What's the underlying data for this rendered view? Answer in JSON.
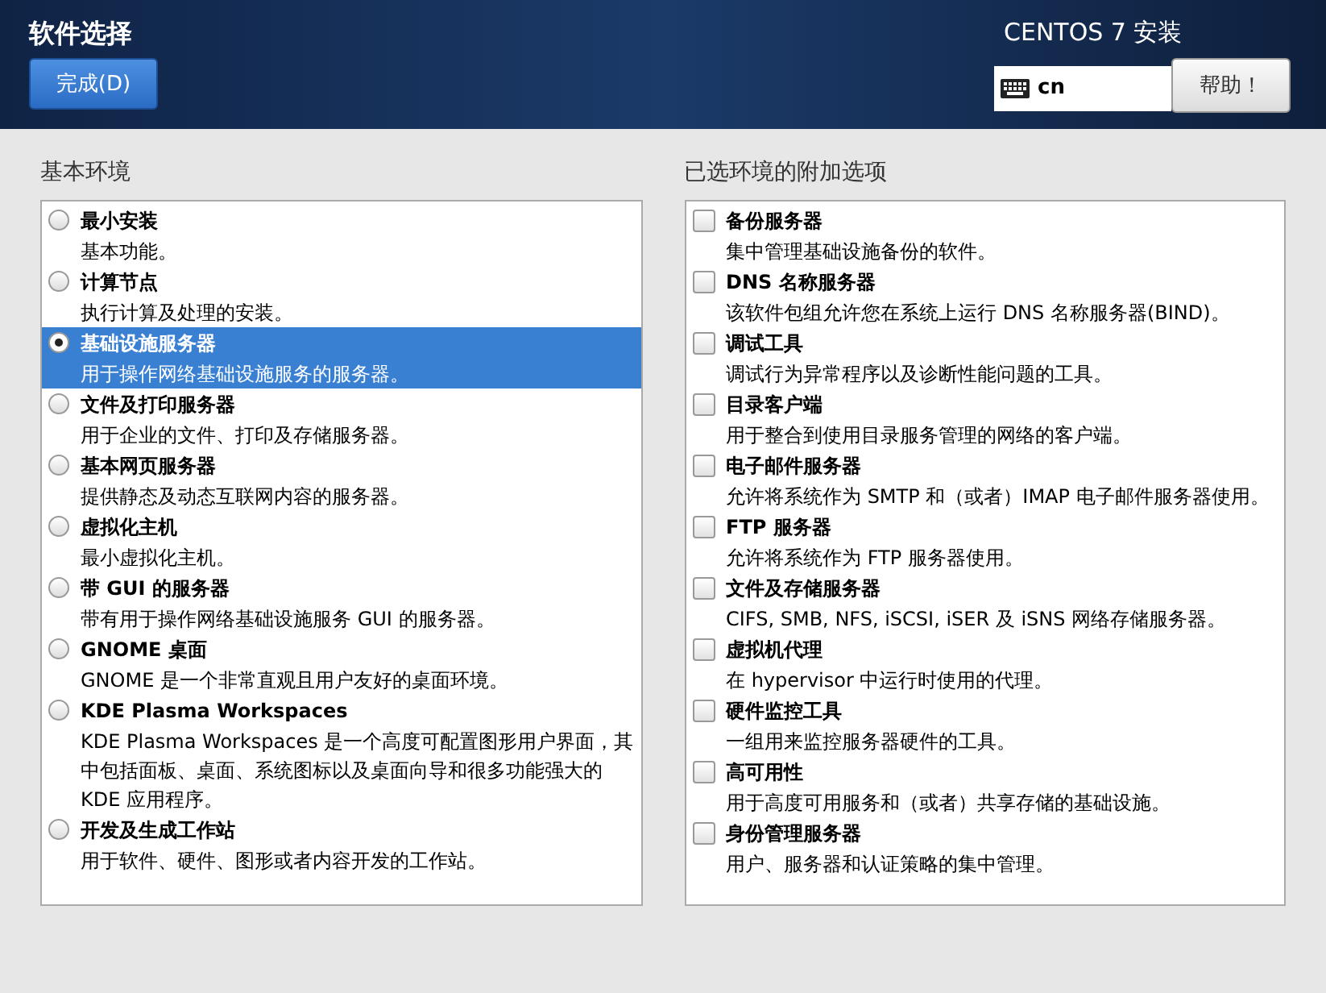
{
  "header": {
    "title": "软件选择",
    "done_button": "完成(D)",
    "product": "CENTOS 7 安装",
    "keyboard": "cn",
    "help_button": "帮助！"
  },
  "environments": {
    "heading": "基本环境",
    "items": [
      {
        "name": "最小安装",
        "description": "基本功能。",
        "selected": false
      },
      {
        "name": "计算节点",
        "description": "执行计算及处理的安装。",
        "selected": false
      },
      {
        "name": "基础设施服务器",
        "description": "用于操作网络基础设施服务的服务器。",
        "selected": true
      },
      {
        "name": "文件及打印服务器",
        "description": "用于企业的文件、打印及存储服务器。",
        "selected": false
      },
      {
        "name": "基本网页服务器",
        "description": "提供静态及动态互联网内容的服务器。",
        "selected": false
      },
      {
        "name": "虚拟化主机",
        "description": "最小虚拟化主机。",
        "selected": false
      },
      {
        "name": "带 GUI 的服务器",
        "description": "带有用于操作网络基础设施服务 GUI 的服务器。",
        "selected": false
      },
      {
        "name": "GNOME 桌面",
        "description": "GNOME 是一个非常直观且用户友好的桌面环境。",
        "selected": false
      },
      {
        "name": "KDE Plasma Workspaces",
        "description": "KDE Plasma Workspaces 是一个高度可配置图形用户界面，其中包括面板、桌面、系统图标以及桌面向导和很多功能强大的 KDE 应用程序。",
        "selected": false
      },
      {
        "name": "开发及生成工作站",
        "description": "用于软件、硬件、图形或者内容开发的工作站。",
        "selected": false
      }
    ]
  },
  "addons": {
    "heading": "已选环境的附加选项",
    "items": [
      {
        "name": "备份服务器",
        "description": "集中管理基础设施备份的软件。",
        "checked": false
      },
      {
        "name": "DNS 名称服务器",
        "description": "该软件包组允许您在系统上运行 DNS 名称服务器(BIND)。",
        "checked": false
      },
      {
        "name": "调试工具",
        "description": "调试行为异常程序以及诊断性能问题的工具。",
        "checked": false
      },
      {
        "name": "目录客户端",
        "description": "用于整合到使用目录服务管理的网络的客户端。",
        "checked": false
      },
      {
        "name": "电子邮件服务器",
        "description": "允许将系统作为 SMTP 和（或者）IMAP 电子邮件服务器使用。",
        "checked": false
      },
      {
        "name": "FTP 服务器",
        "description": "允许将系统作为 FTP 服务器使用。",
        "checked": false
      },
      {
        "name": "文件及存储服务器",
        "description": "CIFS, SMB, NFS, iSCSI, iSER 及 iSNS 网络存储服务器。",
        "checked": false
      },
      {
        "name": "虚拟机代理",
        "description": "在 hypervisor 中运行时使用的代理。",
        "checked": false
      },
      {
        "name": "硬件监控工具",
        "description": "一组用来监控服务器硬件的工具。",
        "checked": false
      },
      {
        "name": "高可用性",
        "description": "用于高度可用服务和（或者）共享存储的基础设施。",
        "checked": false
      },
      {
        "name": "身份管理服务器",
        "description": "用户、服务器和认证策略的集中管理。",
        "checked": false
      }
    ]
  }
}
